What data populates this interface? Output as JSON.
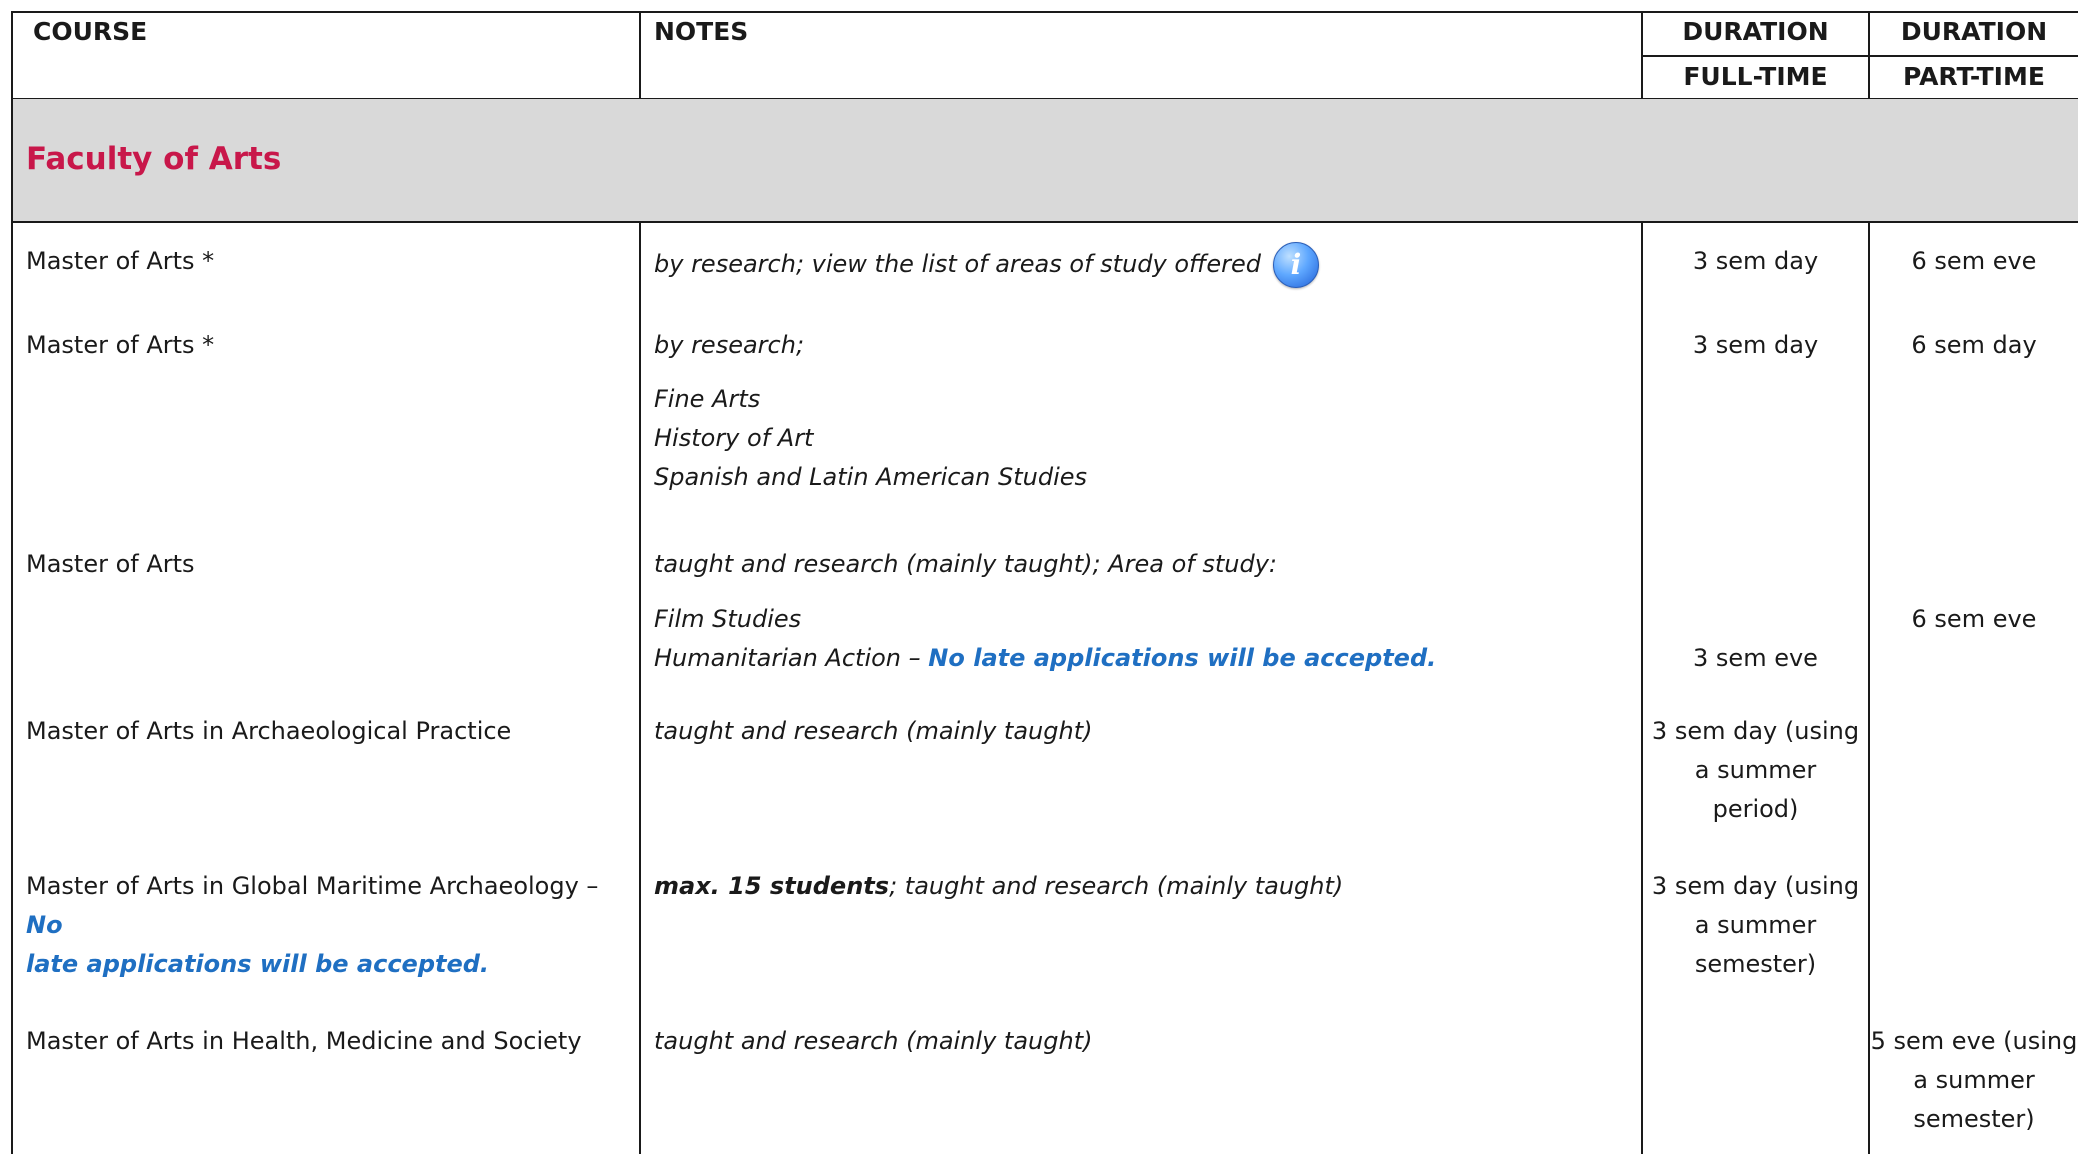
{
  "headers": {
    "course": "COURSE",
    "notes": "NOTES",
    "duration_ft": "DURATION",
    "full_time": "FULL-TIME",
    "duration_pt": "DURATION",
    "part_time": "PART-TIME"
  },
  "faculty": {
    "title": "Faculty of Arts"
  },
  "rows": [
    {
      "course": "Master of Arts *",
      "notes": "by research; view the list of areas of study offered",
      "ft": "3 sem day",
      "pt": "6 sem eve"
    },
    {
      "course": "Master of Arts *",
      "notes": "by research;",
      "areas": [
        "Fine Arts",
        "History of Art",
        "Spanish and Latin American Studies"
      ],
      "ft": "3 sem day",
      "pt": "6 sem day"
    },
    {
      "course": "Master of Arts",
      "notes": "taught and research (mainly taught); Area of study:",
      "area1": "Film Studies",
      "area2": "Humanitarian Action –",
      "area2_warning": "No late applications will be accepted.",
      "ft": "3 sem eve",
      "pt": "6 sem eve"
    },
    {
      "course": "Master of Arts in Archaeological Practice",
      "notes": "taught and research (mainly taught)",
      "ft": [
        "3 sem day (using",
        "a summer",
        "period)"
      ]
    },
    {
      "course": "Master of Arts in Global Maritime Archaeology –",
      "course_warning_1": "No",
      "course_warning_2": "late applications will be accepted.",
      "notes_bold": "max. 15 students",
      "notes": "; taught and research (mainly taught)",
      "ft": [
        "3 sem day (using",
        "a summer",
        "semester)"
      ]
    },
    {
      "course": "Master of Arts in Health, Medicine and Society",
      "notes": "taught and research (mainly taught)",
      "pt": [
        "5 sem eve (using",
        "a summer",
        "semester)"
      ]
    }
  ]
}
